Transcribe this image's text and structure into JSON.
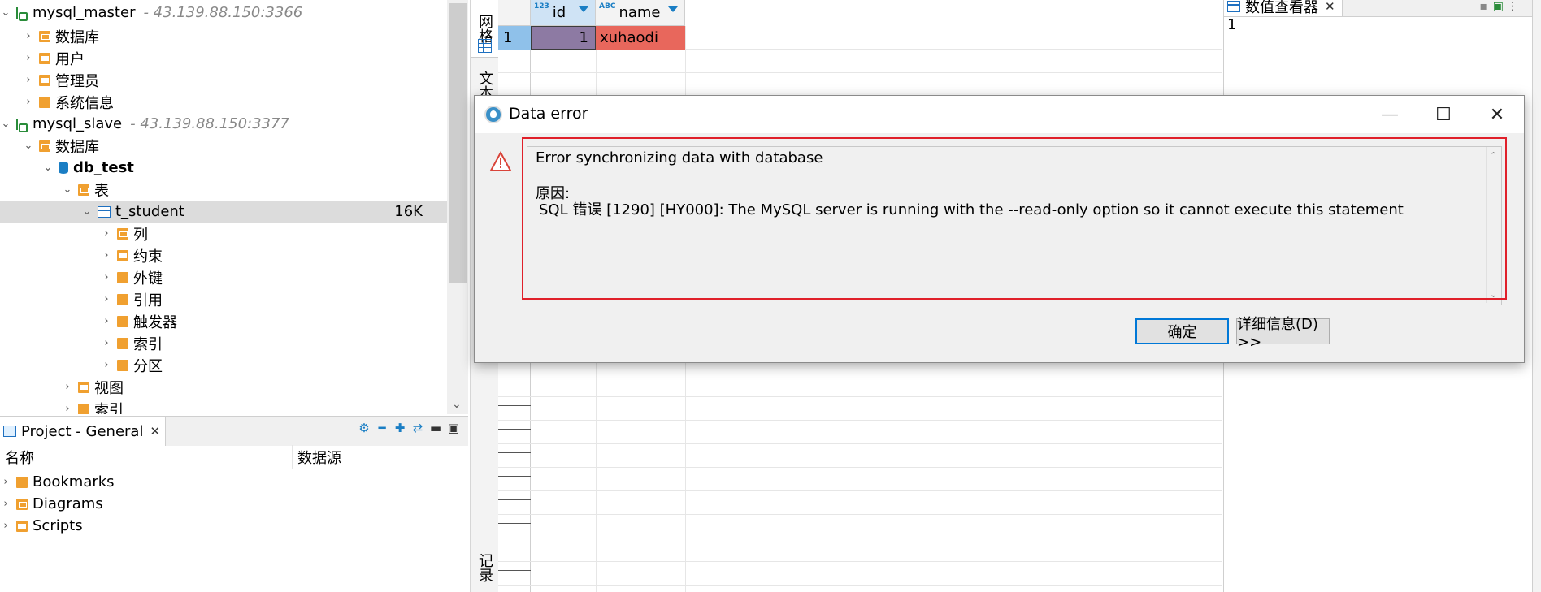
{
  "navigator": {
    "master": {
      "name": "mysql_master",
      "address": "- 43.139.88.150:3366"
    },
    "master_children": [
      "数据库",
      "用户",
      "管理员",
      "系统信息"
    ],
    "slave": {
      "name": "mysql_slave",
      "address": "- 43.139.88.150:3377"
    },
    "slave_db_folder": "数据库",
    "database": "db_test",
    "tables_folder": "表",
    "table": {
      "name": "t_student",
      "size": "16K"
    },
    "table_children": [
      "列",
      "约束",
      "外键",
      "引用",
      "触发器",
      "索引",
      "分区"
    ],
    "views_folder": "视图",
    "indexes_folder": "索引"
  },
  "project": {
    "tab_label": "Project - General",
    "col_name": "名称",
    "col_datasource": "数据源",
    "items": [
      "Bookmarks",
      "Diagrams",
      "Scripts"
    ]
  },
  "side_tabs": {
    "grid": "网格",
    "text": "文本",
    "record": "记录"
  },
  "grid": {
    "columns": [
      {
        "type": "123",
        "name": "id"
      },
      {
        "type": "ABC",
        "name": "name"
      }
    ],
    "rows": [
      {
        "num": "1",
        "id": "1",
        "name": "xuhaodi"
      }
    ]
  },
  "value_viewer": {
    "title": "数值查看器",
    "value": "1"
  },
  "dialog": {
    "title": "Data error",
    "line1": "Error synchronizing data with database",
    "cause_label": "原因:",
    "detail": "SQL 错误 [1290] [HY000]: The MySQL server is running with the --read-only option so it cannot execute this statement",
    "ok": "确定",
    "details": "详细信息(D) >>"
  },
  "colors": {
    "selected_id_cell": "#8d7aa3",
    "selected_name_cell": "#e8675c",
    "highlight_border": "#e0202a",
    "accent": "#1a7ec4"
  }
}
